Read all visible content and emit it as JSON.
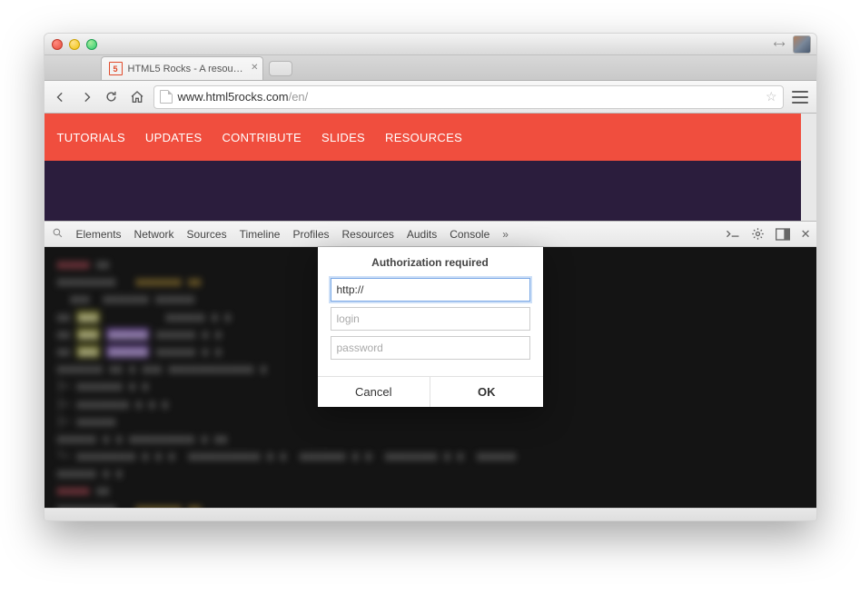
{
  "tab": {
    "title": "HTML5 Rocks - A resource",
    "favicon_label": "5"
  },
  "toolbar": {
    "url_host": "www.html5rocks.com",
    "url_path": "/en/"
  },
  "site_nav": {
    "items": [
      "TUTORIALS",
      "UPDATES",
      "CONTRIBUTE",
      "SLIDES",
      "RESOURCES"
    ]
  },
  "devtools": {
    "tabs": [
      "Elements",
      "Network",
      "Sources",
      "Timeline",
      "Profiles",
      "Resources",
      "Audits",
      "Console"
    ]
  },
  "dialog": {
    "title": "Authorization required",
    "url_value": "http://",
    "login_placeholder": "login",
    "password_placeholder": "password",
    "cancel_label": "Cancel",
    "ok_label": "OK"
  }
}
